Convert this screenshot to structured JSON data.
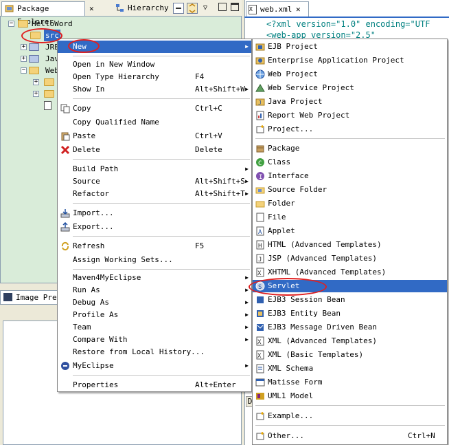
{
  "package_explorer": {
    "tab_label": "Package Explorer",
    "tab2_label": "Hierarchy",
    "tree": [
      {
        "label": "HelloWord"
      },
      {
        "label": "src"
      },
      {
        "label": "JRE"
      },
      {
        "label": "Jav"
      },
      {
        "label": "Web"
      }
    ]
  },
  "image_preview": {
    "tab_label": "Image Prev"
  },
  "editor": {
    "tab_label": "web.xml",
    "lines": [
      "<?xml version=\"1.0\" encoding=\"UTF",
      "<web-app version=\"2.5\""
    ],
    "bottom_letter": "D"
  },
  "context_menu": {
    "items": [
      {
        "label": "New",
        "shortcut": "",
        "submenu": true
      },
      {
        "label": "Open in New Window",
        "shortcut": ""
      },
      {
        "label": "Open Type Hierarchy",
        "shortcut": "F4"
      },
      {
        "label": "Show In",
        "shortcut": "Alt+Shift+W",
        "submenu": true
      },
      {
        "label": "Copy",
        "shortcut": "Ctrl+C"
      },
      {
        "label": "Copy Qualified Name",
        "shortcut": ""
      },
      {
        "label": "Paste",
        "shortcut": "Ctrl+V"
      },
      {
        "label": "Delete",
        "shortcut": "Delete"
      },
      {
        "label": "Build Path",
        "shortcut": "",
        "submenu": true
      },
      {
        "label": "Source",
        "shortcut": "Alt+Shift+S",
        "submenu": true
      },
      {
        "label": "Refactor",
        "shortcut": "Alt+Shift+T",
        "submenu": true
      },
      {
        "label": "Import...",
        "shortcut": ""
      },
      {
        "label": "Export...",
        "shortcut": ""
      },
      {
        "label": "Refresh",
        "shortcut": "F5"
      },
      {
        "label": "Assign Working Sets...",
        "shortcut": ""
      },
      {
        "label": "Maven4MyEclipse",
        "shortcut": "",
        "submenu": true
      },
      {
        "label": "Run As",
        "shortcut": "",
        "submenu": true
      },
      {
        "label": "Debug As",
        "shortcut": "",
        "submenu": true
      },
      {
        "label": "Profile As",
        "shortcut": "",
        "submenu": true
      },
      {
        "label": "Team",
        "shortcut": "",
        "submenu": true
      },
      {
        "label": "Compare With",
        "shortcut": "",
        "submenu": true
      },
      {
        "label": "Restore from Local History...",
        "shortcut": ""
      },
      {
        "label": "MyEclipse",
        "shortcut": "",
        "submenu": true
      },
      {
        "label": "Properties",
        "shortcut": "Alt+Enter"
      }
    ]
  },
  "new_submenu": {
    "items": [
      {
        "label": "EJB Project"
      },
      {
        "label": "Enterprise Application Project"
      },
      {
        "label": "Web Project"
      },
      {
        "label": "Web Service Project"
      },
      {
        "label": "Java Project"
      },
      {
        "label": "Report Web Project"
      },
      {
        "label": "Project..."
      },
      {
        "label": "Package"
      },
      {
        "label": "Class"
      },
      {
        "label": "Interface"
      },
      {
        "label": "Source Folder"
      },
      {
        "label": "Folder"
      },
      {
        "label": "File"
      },
      {
        "label": "Applet"
      },
      {
        "label": "HTML (Advanced Templates)"
      },
      {
        "label": "JSP (Advanced Templates)"
      },
      {
        "label": "XHTML (Advanced Templates)"
      },
      {
        "label": "Servlet"
      },
      {
        "label": "EJB3 Session Bean"
      },
      {
        "label": "EJB3 Entity Bean"
      },
      {
        "label": "EJB3 Message Driven Bean"
      },
      {
        "label": "XML (Advanced Templates)"
      },
      {
        "label": "XML (Basic Templates)"
      },
      {
        "label": "XML Schema"
      },
      {
        "label": "Matisse Form"
      },
      {
        "label": "UML1 Model"
      },
      {
        "label": "Example..."
      },
      {
        "label": "Other...",
        "shortcut": "Ctrl+N"
      }
    ]
  },
  "colors": {
    "selection": "#316ac5",
    "annotation": "#e02020",
    "explorer_bg": "#d9ecd9"
  }
}
